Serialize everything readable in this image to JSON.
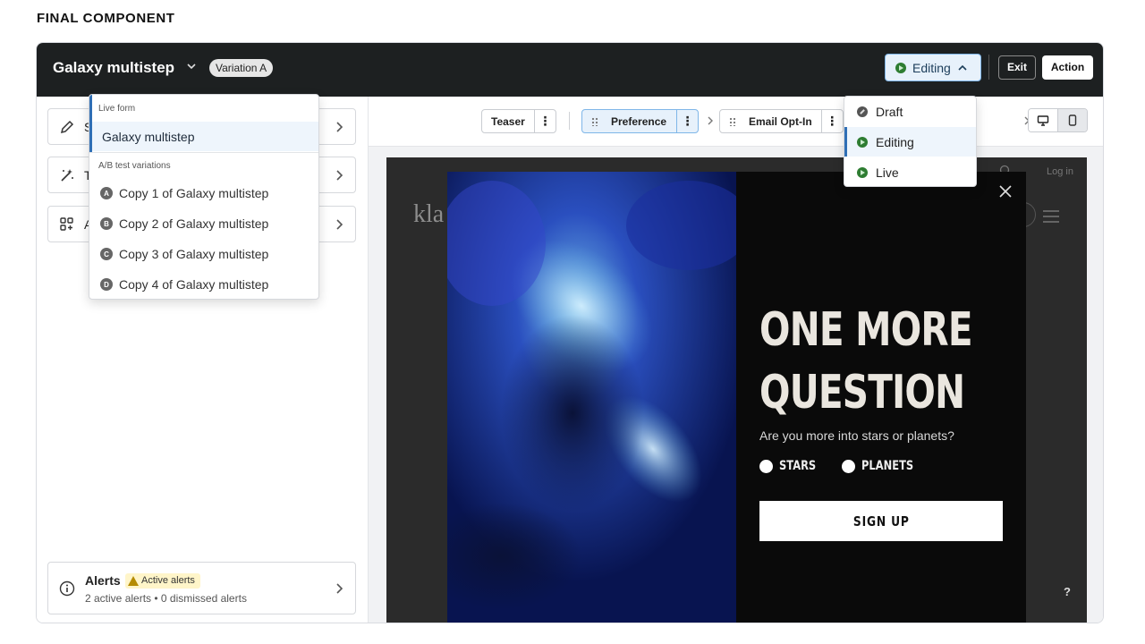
{
  "caption": "FINAL COMPONENT",
  "header": {
    "title": "Galaxy multistep",
    "variation_badge": "Variation A",
    "status_label": "Editing",
    "exit_label": "Exit",
    "action_label": "Action"
  },
  "sidebar": {
    "cards": [
      {
        "initial": "S",
        "icon": "pencil-icon"
      },
      {
        "initial": "T",
        "icon": "magic-wand-icon"
      },
      {
        "initial": "A",
        "icon": "apps-add-icon"
      }
    ],
    "alerts": {
      "title": "Alerts",
      "badge": "Active alerts",
      "subtitle": "2 active alerts • 0 dismissed alerts"
    }
  },
  "form_menu": {
    "live_heading": "Live form",
    "live_item": "Galaxy multistep",
    "ab_heading": "A/B test variations",
    "variations": [
      {
        "letter": "A",
        "label": "Copy 1 of Galaxy multistep"
      },
      {
        "letter": "B",
        "label": "Copy 2 of Galaxy multistep"
      },
      {
        "letter": "C",
        "label": "Copy 3 of Galaxy multistep"
      },
      {
        "letter": "D",
        "label": "Copy 4 of Galaxy multistep"
      }
    ]
  },
  "status_menu": {
    "items": [
      {
        "label": "Draft",
        "state": "draft"
      },
      {
        "label": "Editing",
        "state": "editing",
        "selected": true
      },
      {
        "label": "Live",
        "state": "live"
      }
    ]
  },
  "steps": {
    "teaser": "Teaser",
    "preference": "Preference",
    "email_opt_in": "Email Opt-In"
  },
  "preview": {
    "site_logo": "kla",
    "login": "Log in",
    "help": "?",
    "headline_line1": "ONE MORE",
    "headline_line2": "QUESTION",
    "question": "Are you more into stars or planets?",
    "options": [
      "STARS",
      "PLANETS"
    ],
    "signup": "SIGN UP"
  },
  "colors": {
    "topbar": "#1d2021",
    "accent_blue": "#2f6fb5",
    "status_green": "#2e7d32",
    "modal_bg": "#0a0a0a"
  }
}
